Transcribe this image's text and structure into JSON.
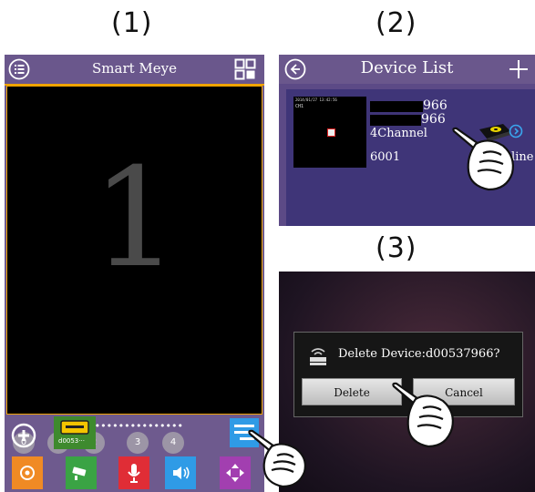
{
  "steps": {
    "one": "(1)",
    "two": "(2)",
    "three": "(3)"
  },
  "panel1": {
    "title": "Smart Meye",
    "video_number": "1",
    "page_dots": "●•••••••••••••••",
    "channels": [
      "0",
      "1",
      "2",
      "3",
      "4"
    ],
    "device_label": "d0053···",
    "toolbar_icons": [
      "ptz-icon",
      "camera-icon",
      "microphone-icon",
      "speaker-icon",
      "direction-icon"
    ],
    "colors": {
      "accent": "#f0a400",
      "bg": "#6e5a8e"
    }
  },
  "panel2": {
    "title": "Device List",
    "thumb_time": "2014/01/27 13:42:56",
    "thumb_channel": "CH1",
    "id_line1": "966",
    "id_line2": "966",
    "channels": "4Channel",
    "port": "6001",
    "status": "Online"
  },
  "panel3": {
    "message": "Delete Device:d00537966?",
    "delete_label": "Delete",
    "cancel_label": "Cancel"
  }
}
